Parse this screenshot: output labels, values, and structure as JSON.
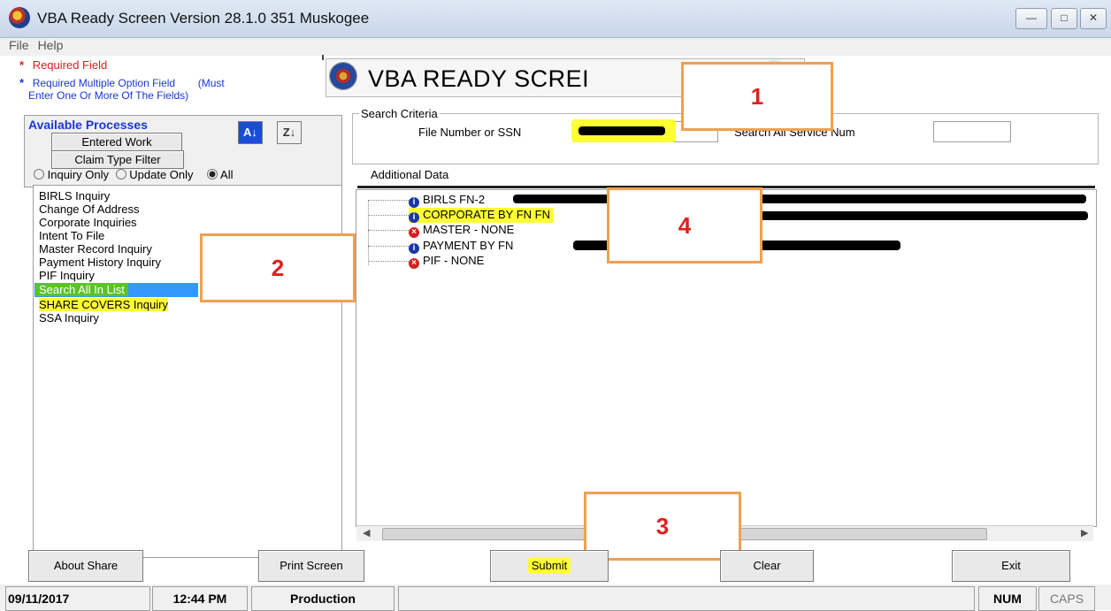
{
  "window": {
    "title": "VBA Ready Screen Version 28.1.0   351 Muskogee"
  },
  "menu": [
    "File",
    "Help"
  ],
  "legend": {
    "required": "Required Field",
    "required_multi_line1": "Required Multiple Option Field",
    "required_multi_note": "(Must",
    "required_multi_line2": "Enter One Or More Of The Fields)"
  },
  "header": {
    "title": "VBA READY SCREI"
  },
  "processes": {
    "title": "Available Processes",
    "entered_work": "Entered Work",
    "claim_type_filter": "Claim Type Filter",
    "radio_inquiry": "Inquiry Only",
    "radio_update": "Update Only",
    "radio_all": "All",
    "items": [
      "BIRLS Inquiry",
      "Change Of Address",
      "Corporate Inquiries",
      "Intent To File",
      "Master Record Inquiry",
      "Payment History Inquiry",
      "PIF Inquiry",
      "Search All In List",
      "SHARE COVERS Inquiry",
      "SSA Inquiry"
    ],
    "selected": "Search All In List"
  },
  "search": {
    "legend": "Search Criteria",
    "file_number_label": "File Number or SSN",
    "service_num_label": "Search All Service Num",
    "additional_data_label": "Additional Data"
  },
  "results": [
    {
      "text": "BIRLS  FN-2",
      "status": "info"
    },
    {
      "text": "CORPORATE BY FN FN",
      "status": "info"
    },
    {
      "text": "MASTER - NONE",
      "status": "error"
    },
    {
      "text": "PAYMENT BY FN ",
      "status": "info"
    },
    {
      "text": "PIF - NONE",
      "status": "error"
    }
  ],
  "callouts": [
    "1",
    "2",
    "3",
    "4"
  ],
  "buttons": {
    "about": "About Share",
    "print": "Print Screen",
    "submit": "Submit",
    "clear": "Clear",
    "exit": "Exit"
  },
  "status": {
    "date": "09/11/2017",
    "time": "12:44 PM",
    "env": "Production",
    "num": "NUM",
    "caps": "CAPS"
  },
  "colors": {
    "highlight": "#ffff33",
    "selection": "#3399ff",
    "callout_border": "#f0a050",
    "callout_text": "#e02020"
  }
}
